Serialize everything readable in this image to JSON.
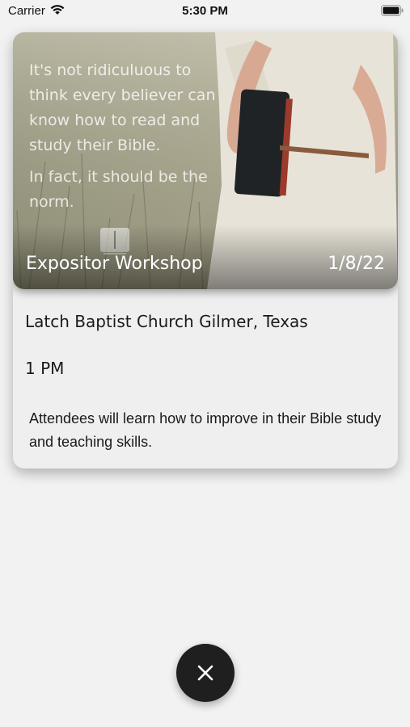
{
  "status_bar": {
    "carrier": "Carrier",
    "time": "5:30 PM"
  },
  "event": {
    "image_quote": [
      "It's not ridiculuous to think every believer can know how to read and study their Bible.",
      "In fact, it should be the norm."
    ],
    "title": "Expositor Workshop",
    "date": "1/8/22",
    "location": "Latch Baptist Church Gilmer, Texas",
    "time": "1 PM",
    "description": "Attendees will learn how to improve in their Bible study and teaching skills."
  },
  "icons": {
    "wifi": "wifi-icon",
    "battery": "battery-icon",
    "close": "close-icon",
    "book": "book-icon"
  }
}
